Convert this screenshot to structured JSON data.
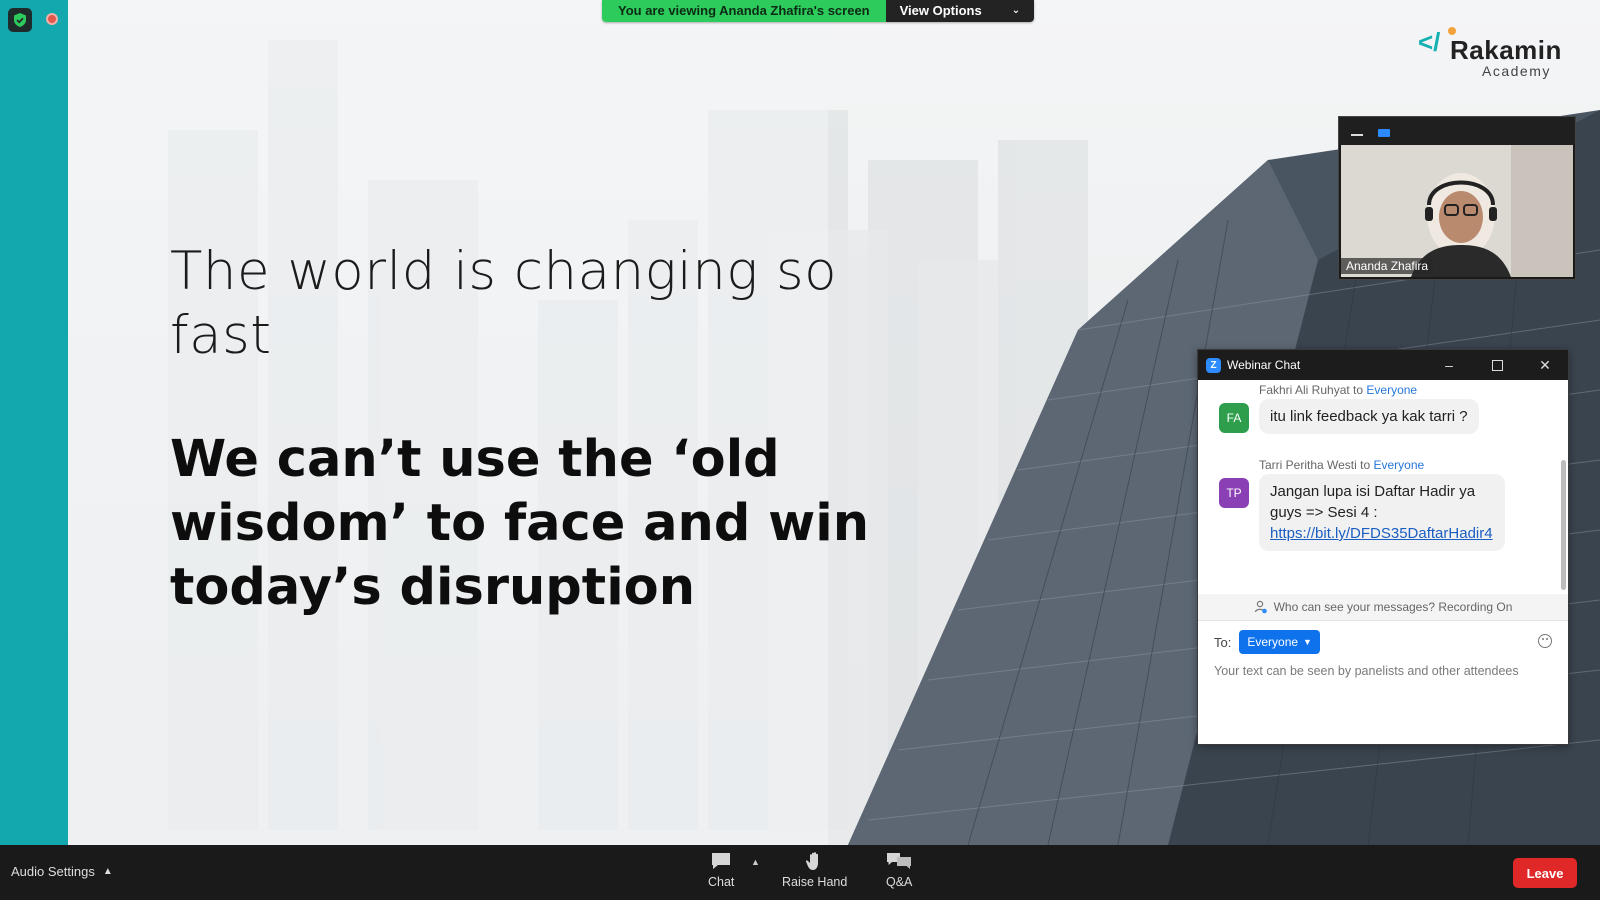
{
  "app": {
    "banner_text": "You are viewing Ananda Zhafira's screen",
    "view_options_label": "View Options"
  },
  "slide": {
    "line1": "The world is changing so fast",
    "line2": "We can’t use the ‘old wisdom’ to face and win today’s disruption",
    "logo_name": "Rakamin",
    "logo_sub": "Academy"
  },
  "video": {
    "participant_name": "Ananda Zhafira"
  },
  "chat": {
    "title": "Webinar Chat",
    "messages": [
      {
        "sender": "Fakhri Ali Ruhyat",
        "to_word": " to ",
        "recipient": "Everyone",
        "initials": "FA",
        "avatar_color": "#2e9e4d",
        "text": "itu link feedback ya kak tarri ?"
      },
      {
        "sender": "Tarri Peritha Westi",
        "to_word": " to ",
        "recipient": "Everyone",
        "initials": "TP",
        "avatar_color": "#8a3fb4",
        "text": "Jangan lupa isi Daftar Hadir ya guys => Sesi 4 :",
        "link": "https://bit.ly/DFDS35DaftarHadir4"
      }
    ],
    "privacy_text": "Who can see your messages? Recording On",
    "to_label": "To:",
    "to_value": "Everyone",
    "input_placeholder": "Your text can be seen by panelists and other attendees"
  },
  "toolbar": {
    "audio_settings_label": "Audio Settings",
    "chat_label": "Chat",
    "raise_hand_label": "Raise Hand",
    "qa_label": "Q&A",
    "leave_label": "Leave"
  },
  "colors": {
    "accent_teal": "#13a8ad",
    "banner_green": "#2dcb5b",
    "zoom_blue": "#0e72ed",
    "leave_red": "#e02828"
  }
}
